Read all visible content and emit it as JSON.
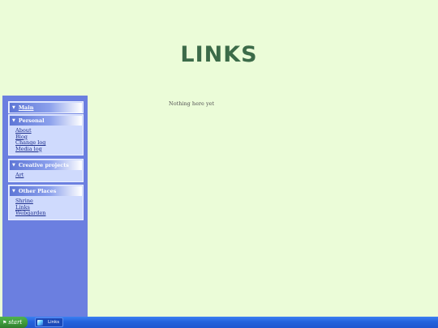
{
  "page": {
    "title": "LINKS",
    "content_text": "Nothing here yet"
  },
  "sidebar": {
    "sections": [
      {
        "title": "Main",
        "links": []
      },
      {
        "title": "Personal",
        "links": [
          "About",
          "Blog",
          "Change log",
          "Media log"
        ]
      },
      {
        "title": "Creative projects",
        "links": [
          "Art"
        ]
      },
      {
        "title": "Other Places",
        "links": [
          "Shrine",
          "Links",
          "Webgarden"
        ]
      }
    ]
  },
  "taskbar": {
    "start_label": "start",
    "task_label": "Links"
  },
  "colors": {
    "background": "#ebfcd8",
    "sidebar": "#6b7fe0",
    "title": "#3c6b49"
  }
}
